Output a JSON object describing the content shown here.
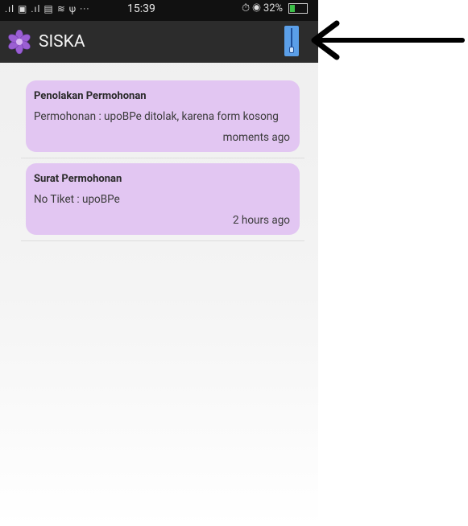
{
  "status_bar": {
    "left_icons": ".ıl ▣ .ıl ▤ ≋ ψ ···",
    "time": "15:39",
    "right_icons": "⏱ ◉",
    "battery_text": "32%",
    "battery_level": 0.32
  },
  "app_bar": {
    "title": "SISKA",
    "logo_icon": "flower-logo-icon",
    "action_icon": "zipper-icon",
    "accent_color": "#5b9fe8"
  },
  "notifications": [
    {
      "title": "Penolakan Permohonan",
      "body": "Permohonan : upoBPe ditolak, karena form kosong",
      "time": "moments ago"
    },
    {
      "title": "Surat Permohonan",
      "body": "No Tiket : upoBPe",
      "time": "2 hours ago"
    }
  ],
  "colors": {
    "card_background": "#e2c6f2",
    "app_bar_background": "#2c2c2c",
    "status_bar_background": "#111111"
  },
  "annotation": {
    "icon": "arrow-left-icon"
  }
}
